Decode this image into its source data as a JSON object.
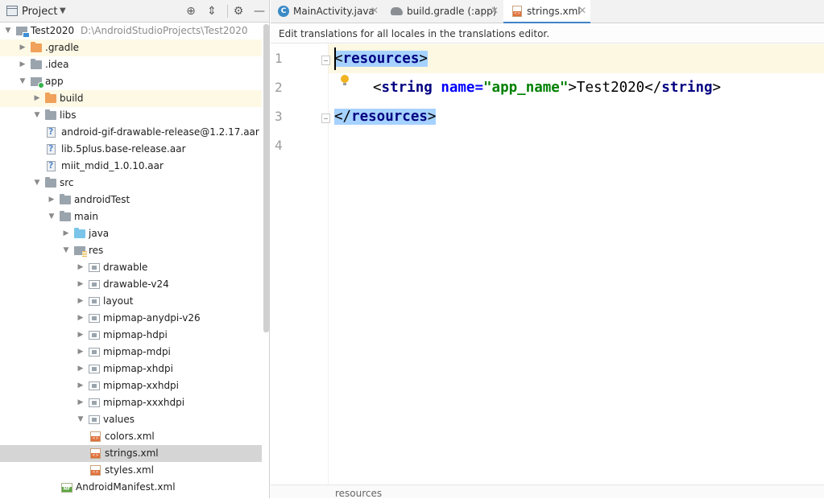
{
  "project_panel": {
    "title": "Project",
    "tree": [
      {
        "label": "Test2020",
        "path": "D:\\AndroidStudioProjects\\Test2020",
        "icon": "project-root-folder-icon",
        "expanded": true,
        "depth": 0
      },
      {
        "label": ".gradle",
        "icon": "orange-folder-icon",
        "expanded": false,
        "depth": 1,
        "highlight": true
      },
      {
        "label": ".idea",
        "icon": "folder-icon",
        "expanded": false,
        "depth": 1
      },
      {
        "label": "app",
        "icon": "module-folder-icon",
        "expanded": true,
        "depth": 1
      },
      {
        "label": "build",
        "icon": "orange-folder-icon",
        "expanded": false,
        "depth": 2,
        "highlight": true
      },
      {
        "label": "libs",
        "icon": "folder-icon",
        "expanded": true,
        "depth": 2
      },
      {
        "label": "android-gif-drawable-release@1.2.17.aar",
        "icon": "unknown-file-icon",
        "depth": 3
      },
      {
        "label": "lib.5plus.base-release.aar",
        "icon": "unknown-file-icon",
        "depth": 3
      },
      {
        "label": "miit_mdid_1.0.10.aar",
        "icon": "unknown-file-icon",
        "depth": 3
      },
      {
        "label": "src",
        "icon": "folder-icon",
        "expanded": true,
        "depth": 2
      },
      {
        "label": "androidTest",
        "icon": "folder-icon",
        "expanded": false,
        "depth": 3
      },
      {
        "label": "main",
        "icon": "folder-icon",
        "expanded": true,
        "depth": 3
      },
      {
        "label": "java",
        "icon": "source-folder-icon",
        "expanded": false,
        "depth": 4
      },
      {
        "label": "res",
        "icon": "resource-folder-icon",
        "expanded": true,
        "depth": 4
      },
      {
        "label": "drawable",
        "icon": "package-folder-icon",
        "expanded": false,
        "depth": 5
      },
      {
        "label": "drawable-v24",
        "icon": "package-folder-icon",
        "expanded": false,
        "depth": 5
      },
      {
        "label": "layout",
        "icon": "package-folder-icon",
        "expanded": false,
        "depth": 5
      },
      {
        "label": "mipmap-anydpi-v26",
        "icon": "package-folder-icon",
        "expanded": false,
        "depth": 5
      },
      {
        "label": "mipmap-hdpi",
        "icon": "package-folder-icon",
        "expanded": false,
        "depth": 5
      },
      {
        "label": "mipmap-mdpi",
        "icon": "package-folder-icon",
        "expanded": false,
        "depth": 5
      },
      {
        "label": "mipmap-xhdpi",
        "icon": "package-folder-icon",
        "expanded": false,
        "depth": 5
      },
      {
        "label": "mipmap-xxhdpi",
        "icon": "package-folder-icon",
        "expanded": false,
        "depth": 5
      },
      {
        "label": "mipmap-xxxhdpi",
        "icon": "package-folder-icon",
        "expanded": false,
        "depth": 5
      },
      {
        "label": "values",
        "icon": "package-folder-icon",
        "expanded": true,
        "depth": 5
      },
      {
        "label": "colors.xml",
        "icon": "xml-file-icon",
        "depth": 6
      },
      {
        "label": "strings.xml",
        "icon": "xml-file-icon",
        "depth": 6,
        "selected": true
      },
      {
        "label": "styles.xml",
        "icon": "xml-file-icon",
        "depth": 6
      },
      {
        "label": "AndroidManifest.xml",
        "icon": "manifest-file-icon",
        "depth": 4
      }
    ]
  },
  "editor": {
    "tabs": [
      {
        "label": "MainActivity.java",
        "icon": "java-class-icon",
        "active": false
      },
      {
        "label": "build.gradle (:app)",
        "icon": "gradle-icon",
        "active": false
      },
      {
        "label": "strings.xml",
        "icon": "xml-file-icon",
        "active": true
      }
    ],
    "notice": "Edit translations for all locales in the translations editor.",
    "line_numbers": [
      "1",
      "2",
      "3",
      "4"
    ],
    "code": {
      "line1": {
        "open": "<",
        "tag": "resources",
        "close": ">"
      },
      "line2": {
        "open": "<",
        "tag": "string",
        "attr": "name",
        "eq": "=",
        "value": "\"app_name\"",
        "close": ">",
        "text": "Test2020",
        "end_open": "</",
        "end_tag": "string",
        "end_close": ">"
      },
      "line3": {
        "open": "</",
        "tag": "resources",
        "close": ">"
      }
    },
    "breadcrumb": "resources"
  },
  "colors": {
    "selection": "#a6d2ff",
    "caret_line": "#fdf8e2",
    "tag": "#000080",
    "attr": "#0000ff",
    "value": "#008000",
    "active_tab_underline": "#4083c9"
  }
}
